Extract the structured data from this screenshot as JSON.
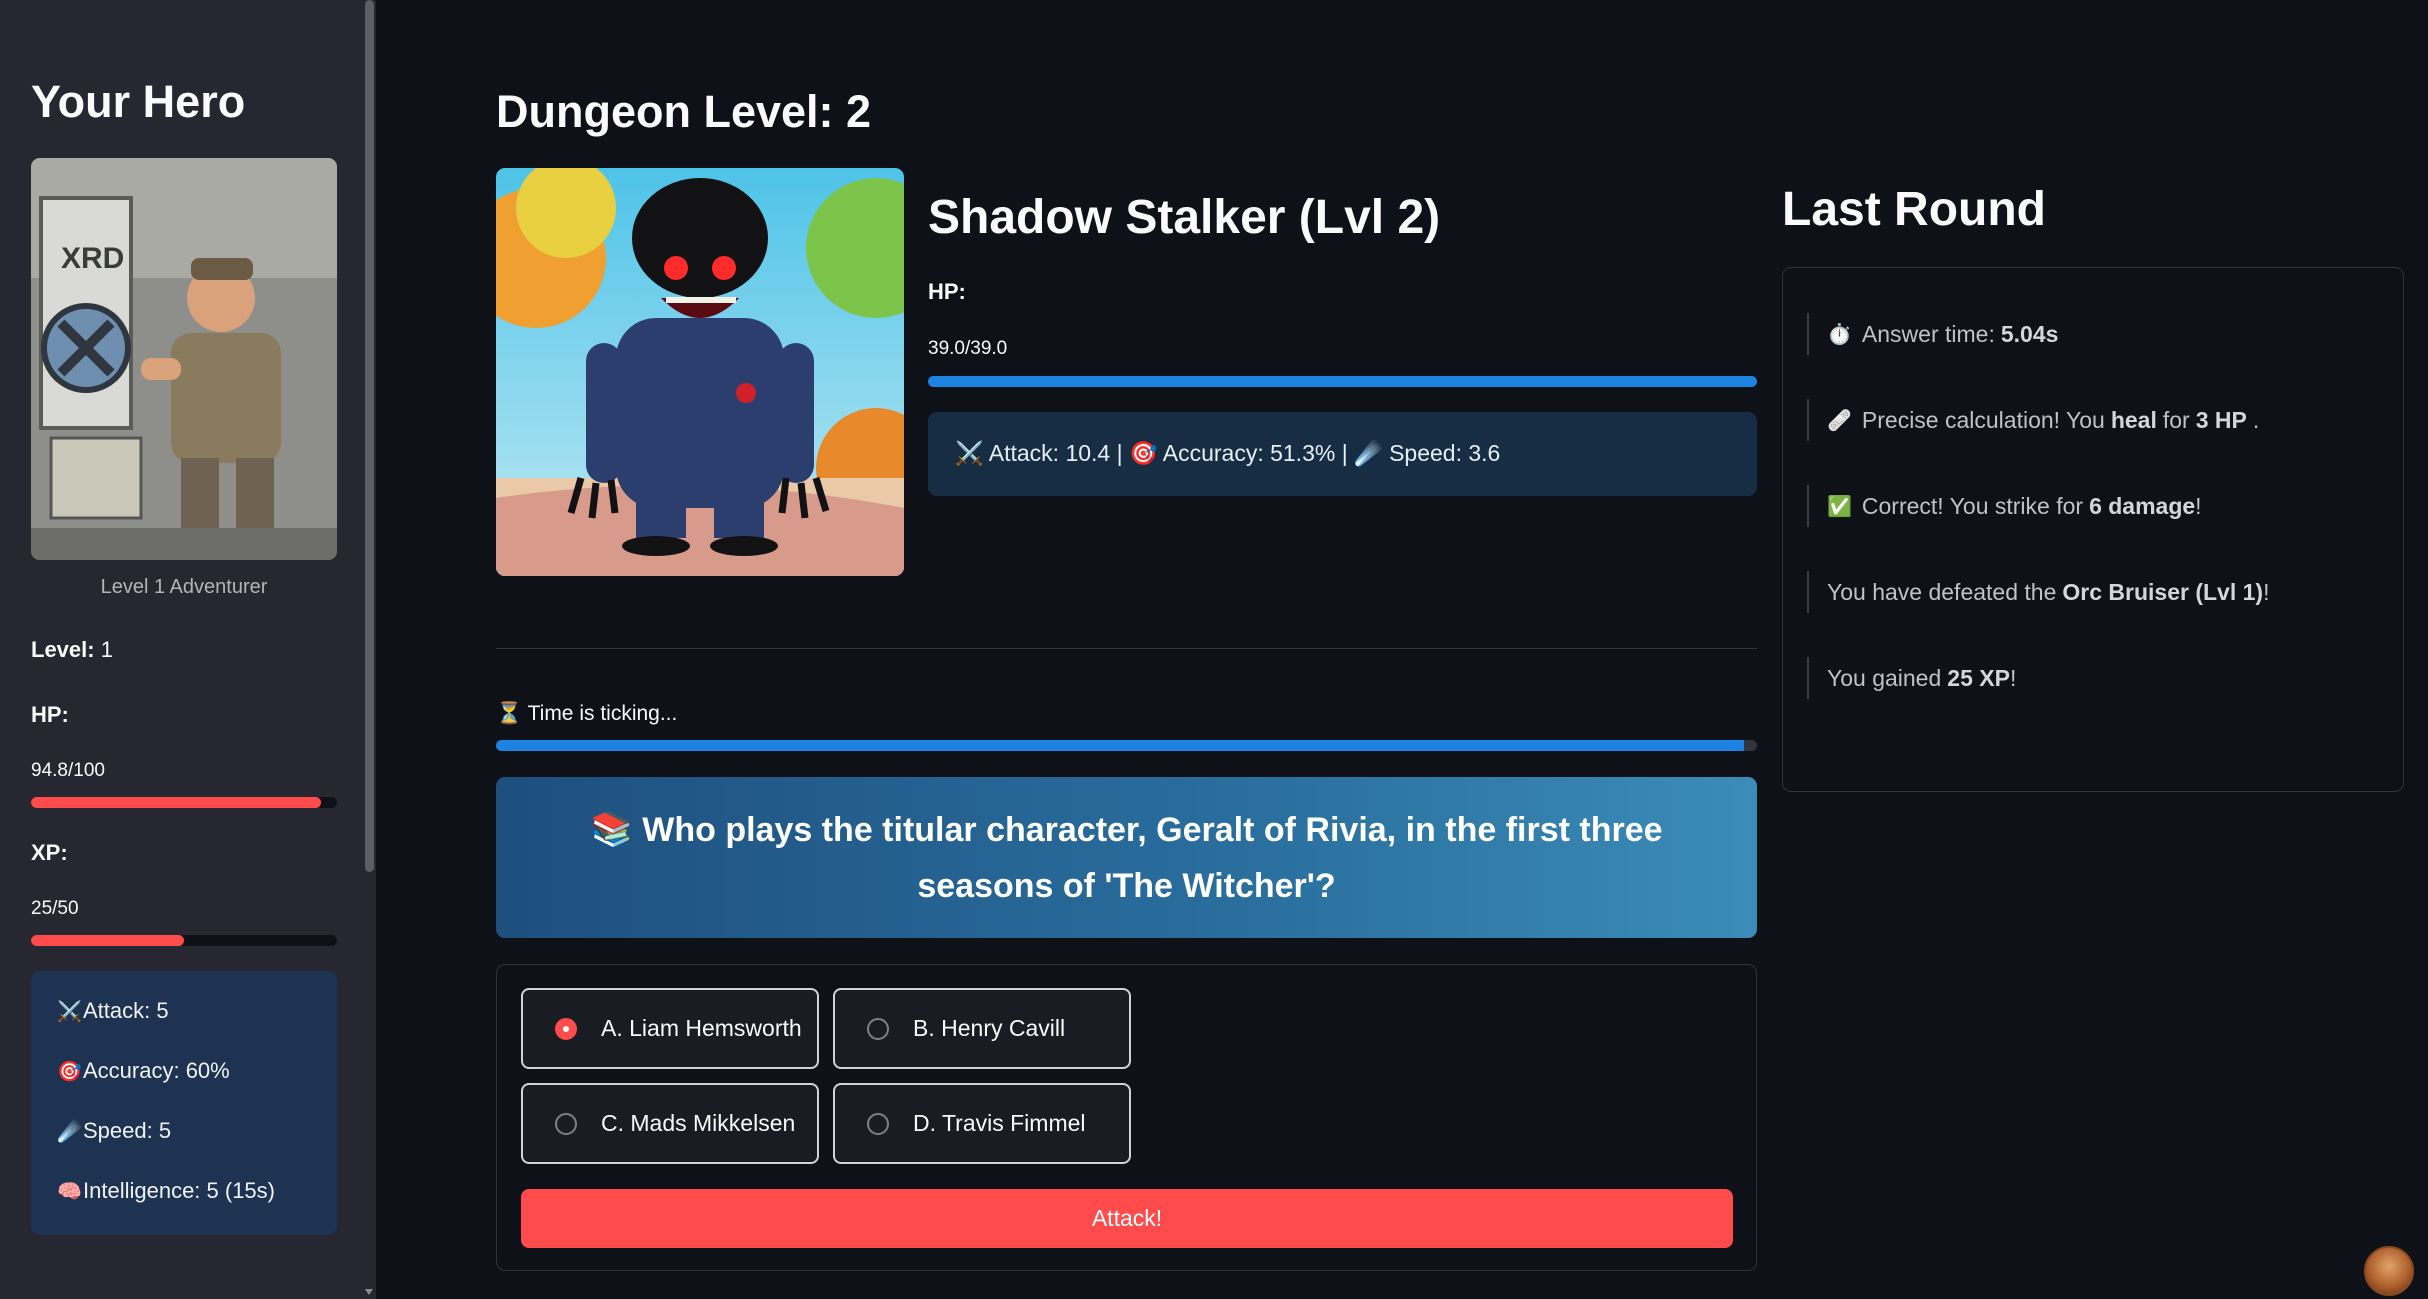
{
  "sidebar": {
    "title": "Your Hero",
    "caption": "Level 1 Adventurer",
    "level_label": "Level:",
    "level_value": "1",
    "hp_label": "HP:",
    "hp_value": "94.8/100",
    "hp_fraction": 0.948,
    "xp_label": "XP:",
    "xp_value": "25/50",
    "xp_fraction": 0.5,
    "stats": [
      {
        "icon": "crossed-swords-icon",
        "emoji": "⚔️",
        "text": "Attack: 5"
      },
      {
        "icon": "target-icon",
        "emoji": "🎯",
        "text": "Accuracy: 60%"
      },
      {
        "icon": "comet-icon",
        "emoji": "☄️",
        "text": "Speed: 5"
      },
      {
        "icon": "brain-icon",
        "emoji": "🧠",
        "text": "Intelligence: 5 (15s)"
      }
    ]
  },
  "main": {
    "dungeon_title": "Dungeon Level: 2",
    "monster": {
      "name": "Shadow Stalker (Lvl 2)",
      "hp_label": "HP:",
      "hp_value": "39.0/39.0",
      "hp_fraction": 1.0,
      "stats_text": "⚔️ Attack: 10.4 | 🎯 Accuracy: 51.3% | ☄️ Speed: 3.6"
    },
    "timer": {
      "text": "⏳ Time is ticking...",
      "fraction": 0.99
    },
    "question": "📚 Who plays the titular character, Geralt of Rivia, in the first three seasons of 'The Witcher'?",
    "options": [
      {
        "label": "A. Liam Hemsworth",
        "selected": true
      },
      {
        "label": "B. Henry Cavill",
        "selected": false
      },
      {
        "label": "C. Mads Mikkelsen",
        "selected": false
      },
      {
        "label": "D. Travis Fimmel",
        "selected": false
      }
    ],
    "attack_button": "Attack!"
  },
  "last_round": {
    "title": "Last Round",
    "items": [
      {
        "emoji": "⏱️",
        "pre": "Answer time:",
        "bold": "5.04s",
        "post": ""
      },
      {
        "emoji": "🩹",
        "pre": "Precise calculation! You",
        "bold": "heal",
        "post": "for 3 HP.",
        "bold2": "3 HP"
      },
      {
        "emoji": "✅",
        "pre": "Correct! You strike for",
        "bold": "6 damage",
        "post": "!"
      },
      {
        "emoji": "",
        "pre": "You have defeated the",
        "bold": "Orc Bruiser (Lvl 1)",
        "post": "!"
      },
      {
        "emoji": "",
        "pre": "You gained",
        "bold": "25 XP",
        "post": "!"
      }
    ]
  },
  "colors": {
    "background": "#0e1117",
    "sidebar": "#262730",
    "accent_red": "#ff4b4b",
    "accent_blue": "#1c83e1"
  }
}
